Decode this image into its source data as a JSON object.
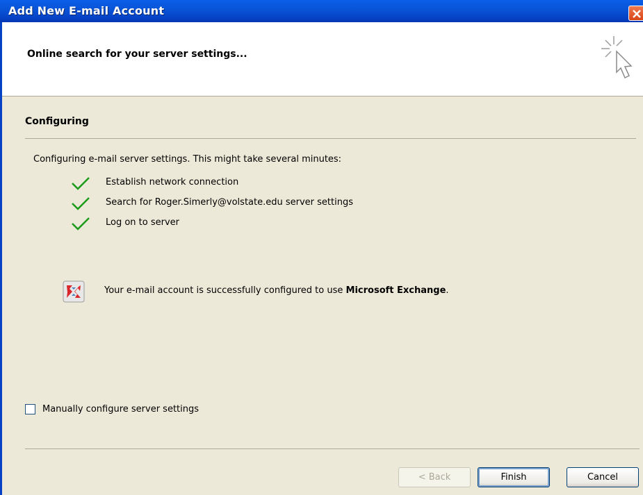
{
  "window": {
    "title": "Add New E-mail Account"
  },
  "header": {
    "text": "Online search for your server settings..."
  },
  "section": {
    "title": "Configuring",
    "description": "Configuring e-mail server settings. This might take several minutes:"
  },
  "steps": [
    {
      "label": "Establish network connection",
      "status": "done"
    },
    {
      "label": "Search for Roger.Simerly@volstate.edu server settings",
      "status": "done"
    },
    {
      "label": "Log on to server",
      "status": "done"
    }
  ],
  "result": {
    "prefix": "Your e-mail account is successfully configured to use ",
    "product": "Microsoft Exchange",
    "suffix": "."
  },
  "manual_config": {
    "label": "Manually configure server settings",
    "checked": false
  },
  "buttons": {
    "back": "< Back",
    "finish": "Finish",
    "cancel": "Cancel"
  },
  "colors": {
    "title_bar": "#0853d6",
    "check": "#1a9b1a",
    "dialog_bg": "#ece9d8"
  }
}
